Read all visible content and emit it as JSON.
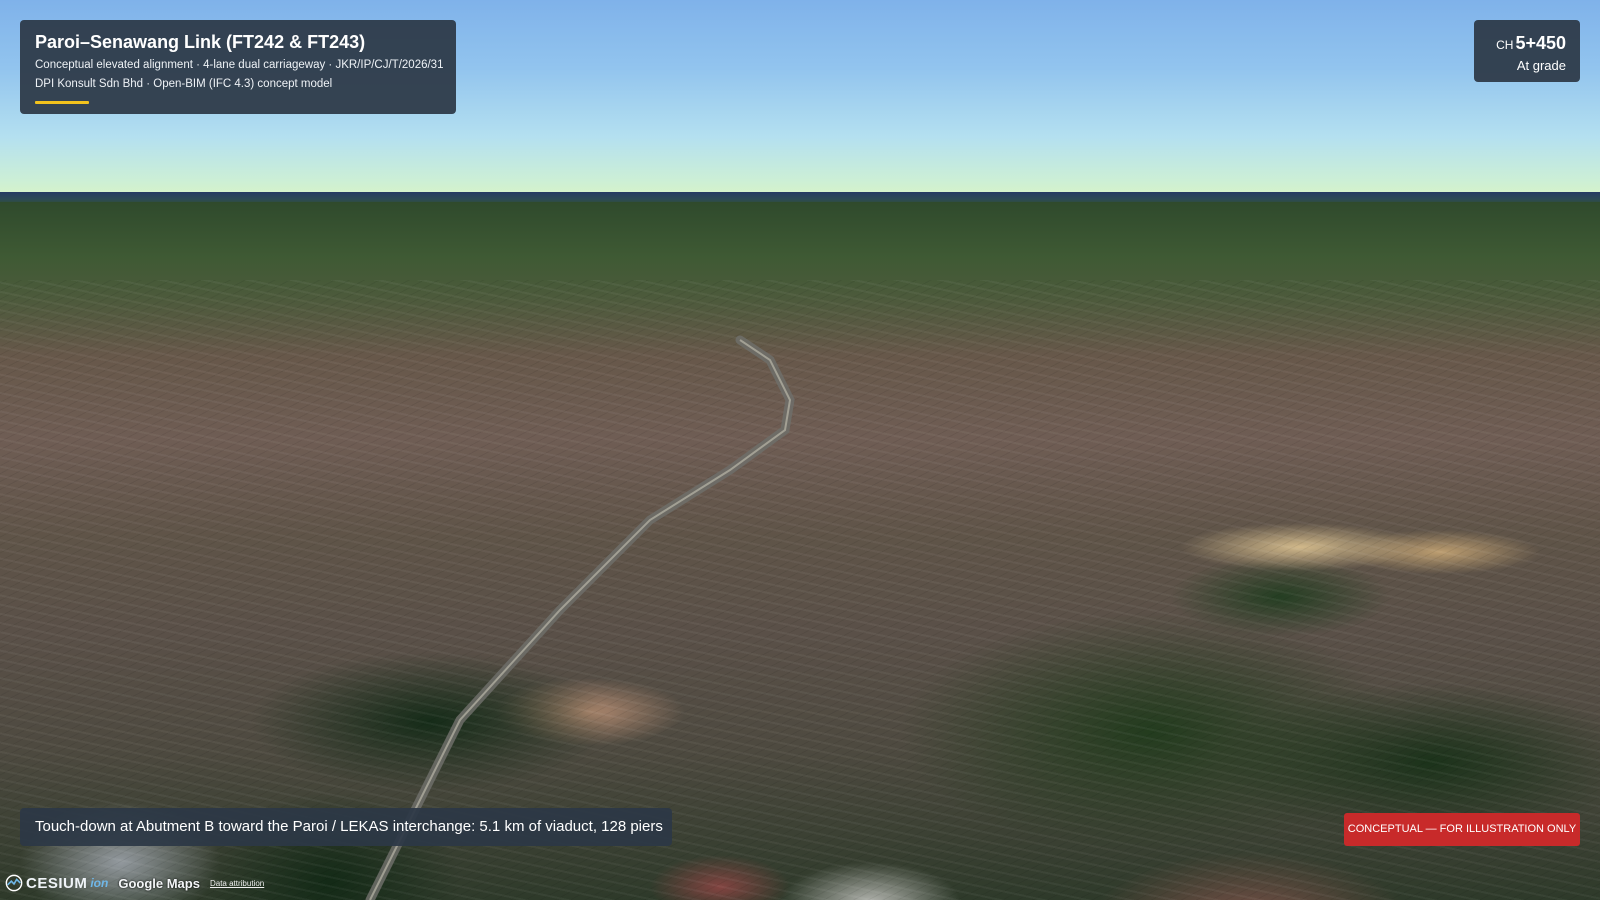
{
  "project": {
    "title": "Paroi–Senawang Link (FT242 & FT243)",
    "subtitle_line1": "Conceptual elevated alignment · 4-lane dual carriageway · JKR/IP/CJ/T/2026/31",
    "subtitle_line2": "DPI Konsult Sdn Bhd · Open-BIM (IFC 4.3) concept model"
  },
  "chainage": {
    "prefix": "CH",
    "value": "5+450",
    "status": "At grade"
  },
  "caption": "Touch-down at Abutment B toward the Paroi / LEKAS interchange: 5.1 km of viaduct, 128 piers",
  "badge": "CONCEPTUAL — FOR ILLUSTRATION ONLY",
  "credits": {
    "cesium": "CESIUM",
    "ion": "ion",
    "google": "Google Maps",
    "attribution": "Data attribution"
  },
  "colors": {
    "panel_bg": "#2c3846",
    "accent_yellow": "#f2c21d",
    "badge_red": "#c82a2a"
  }
}
